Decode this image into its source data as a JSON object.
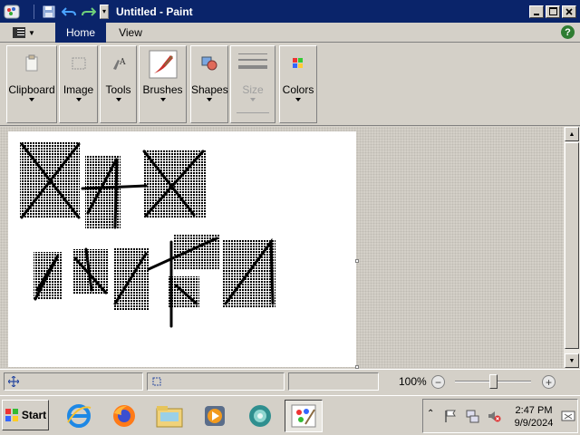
{
  "window": {
    "title": "Untitled - Paint",
    "buttons": {
      "minimize": "minimize",
      "maximize": "maximize",
      "close": "close"
    }
  },
  "quick_access": {
    "items": [
      "save-icon",
      "undo-icon",
      "redo-icon"
    ],
    "customize": "▾"
  },
  "ribbon_tabs": {
    "app_menu": "paint-menu",
    "home": "Home",
    "view": "View",
    "help": "?"
  },
  "ribbon_groups": [
    {
      "key": "clipboard",
      "label": "Clipboard",
      "icon": "clipboard-icon",
      "enabled": true
    },
    {
      "key": "image",
      "label": "Image",
      "icon": "image-select-icon",
      "enabled": true
    },
    {
      "key": "tools",
      "label": "Tools",
      "icon": "tools-icon",
      "enabled": true
    },
    {
      "key": "brushes",
      "label": "Brushes",
      "icon": "brush-icon",
      "enabled": true
    },
    {
      "key": "shapes",
      "label": "Shapes",
      "icon": "shapes-icon",
      "enabled": true
    },
    {
      "key": "size",
      "label": "Size",
      "icon": "size-icon",
      "enabled": false
    },
    {
      "key": "colors",
      "label": "Colors",
      "icon": "palette-icon",
      "enabled": true
    }
  ],
  "statusbar": {
    "zoom": "100%",
    "zoom_level_percent": 100,
    "zoom_out": "−",
    "zoom_in": "+"
  },
  "taskbar": {
    "start": "Start",
    "apps": [
      "internet-explorer-icon",
      "firefox-icon",
      "file-explorer-icon",
      "media-player-icon",
      "network-icon",
      "paint-icon"
    ],
    "active_app": "paint-icon",
    "clock_time": "2:47 PM",
    "clock_date": "9/9/2024"
  },
  "colors": {
    "titlebar": "#0a246a",
    "active_tab": "#0a246a",
    "face": "#d4d0c8",
    "canvas": "#ffffff",
    "drawing": "#000000"
  }
}
